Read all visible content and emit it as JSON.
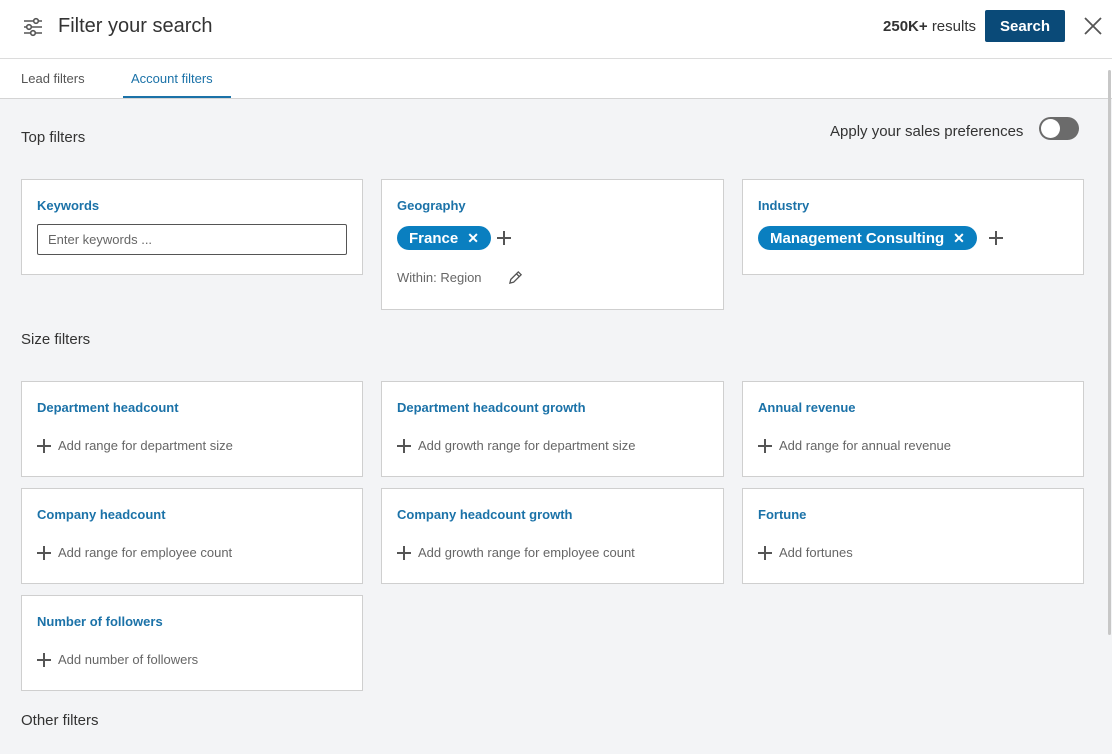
{
  "header": {
    "title": "Filter your search",
    "results_count": "250K+",
    "results_label": "results",
    "search_label": "Search"
  },
  "tabs": [
    {
      "label": "Lead filters",
      "active": false
    },
    {
      "label": "Account filters",
      "active": true
    }
  ],
  "top_filters": {
    "title": "Top filters",
    "preferences_label": "Apply your sales preferences",
    "preferences_on": false,
    "keywords": {
      "title": "Keywords",
      "placeholder": "Enter keywords ..."
    },
    "geography": {
      "title": "Geography",
      "tag": "France",
      "within": "Within: Region"
    },
    "industry": {
      "title": "Industry",
      "tag": "Management Consulting"
    }
  },
  "size_filters": {
    "title": "Size filters",
    "items": [
      {
        "title": "Department headcount",
        "action": "Add range for department size"
      },
      {
        "title": "Department headcount growth",
        "action": "Add growth range for department size"
      },
      {
        "title": "Annual revenue",
        "action": "Add range for annual revenue"
      },
      {
        "title": "Company headcount",
        "action": "Add range for employee count"
      },
      {
        "title": "Company headcount growth",
        "action": "Add growth range for employee count"
      },
      {
        "title": "Fortune",
        "action": "Add fortunes"
      },
      {
        "title": "Number of followers",
        "action": "Add number of followers"
      }
    ]
  },
  "other_filters": {
    "title": "Other filters"
  },
  "colors": {
    "accent": "#1b72a8",
    "button": "#0a4a78",
    "pill": "#0a7fc0"
  },
  "icons": [
    "sliders-icon",
    "close-icon",
    "plus-icon",
    "pencil-icon",
    "x-icon"
  ]
}
